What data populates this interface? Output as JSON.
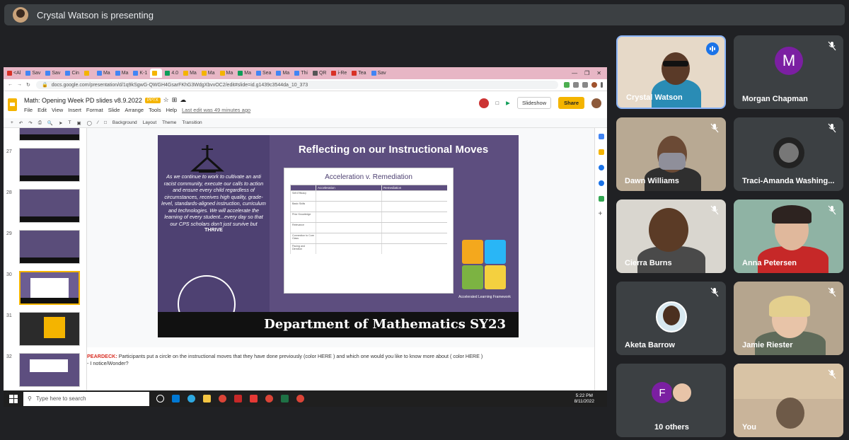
{
  "meeting": {
    "presenting_text": "Crystal Watson is presenting"
  },
  "browser": {
    "tabs": [
      {
        "label": "<Al",
        "color": "#d93025"
      },
      {
        "label": "Sav",
        "color": "#4285f4"
      },
      {
        "label": "Sav",
        "color": "#4285f4"
      },
      {
        "label": "Cin",
        "color": "#4285f4"
      },
      {
        "label": "",
        "color": "#f4b400"
      },
      {
        "label": "Ma",
        "color": "#4285f4"
      },
      {
        "label": "Ma",
        "color": "#4285f4"
      },
      {
        "label": "K-1",
        "color": "#4285f4"
      },
      {
        "label": "",
        "color": "#f4b400"
      },
      {
        "label": "4.0",
        "color": "#0f9d58"
      },
      {
        "label": "Ma",
        "color": "#f4b400"
      },
      {
        "label": "Ma",
        "color": "#f4b400"
      },
      {
        "label": "Ma",
        "color": "#f4b400"
      },
      {
        "label": "Ma",
        "color": "#0f9d58"
      },
      {
        "label": "Sea",
        "color": "#4285f4"
      },
      {
        "label": "Ma",
        "color": "#4285f4"
      },
      {
        "label": "Thi",
        "color": "#4285f4"
      },
      {
        "label": "QR",
        "color": "#555555"
      },
      {
        "label": "i-Re",
        "color": "#d93025"
      },
      {
        "label": "Tea",
        "color": "#d93025"
      },
      {
        "label": "Sav",
        "color": "#4285f4"
      }
    ],
    "url": "docs.google.com/presentation/d/1q9kSgwG-QWGH4GsarFKhG3WdgXbvvOC2/edit#slide=id.g1439c3544da_10_373"
  },
  "doc": {
    "title": "Math: Opening Week PD slides v8.9.2022",
    "badge": "PPTX",
    "menus": [
      "File",
      "Edit",
      "View",
      "Insert",
      "Format",
      "Slide",
      "Arrange",
      "Tools",
      "Help"
    ],
    "last_edit": "Last edit was 49 minutes ago",
    "slideshow_label": "Slideshow",
    "share_label": "Share",
    "toolbar": {
      "background": "Background",
      "layout": "Layout",
      "theme": "Theme",
      "transition": "Transition"
    }
  },
  "filmstrip": {
    "numbers": [
      "27",
      "28",
      "29",
      "30",
      "31",
      "32"
    ],
    "active": "30"
  },
  "slide": {
    "title": "Reflecting on our Instructional Moves",
    "body": "As we continue to work to cultivate an anti racist community, execute our calls to action and ensure every child regardless of circumstances, receives high quality, grade-level, standards-aligned instruction, curriculum and technologies. We will accelerate the learning of every student...every day so that our CPS scholars don't just survive but",
    "body_emphasis": "THRIVE",
    "inner_title": "Acceleration v. Remediation",
    "table_headers": [
      "",
      "Acceleration",
      "Remediation"
    ],
    "table_rows": [
      "Self-Efficacy",
      "Basic Skills",
      "Prior Knowledge",
      "Relevance",
      "Connection to Core Class",
      "Pacing and Direction"
    ],
    "puzzle_label": "Accelerated Learning Framework",
    "footer": "Department of Mathematics   SY23"
  },
  "notes": {
    "prefix": "PEARDECK:",
    "text": " Participants put a circle on the instructional moves that they have done previously (color HERE ) and which one would you like to know more about ( color HERE )",
    "line2": "- I notice/Wonder?"
  },
  "taskbar": {
    "search_placeholder": "Type here to search",
    "time": "5:22 PM",
    "date": "8/11/2022"
  },
  "participants": [
    {
      "name": "Crystal Watson",
      "speaking": true
    },
    {
      "name": "Morgan Chapman",
      "initial": "M",
      "muted": true
    },
    {
      "name": "Dawn Williams",
      "muted": true
    },
    {
      "name": "Traci-Amanda Washing...",
      "muted": true
    },
    {
      "name": "Cierra Burns",
      "muted": true
    },
    {
      "name": "Anna Petersen",
      "muted": true
    },
    {
      "name": "Aketa Barrow",
      "muted": true
    },
    {
      "name": "Jamie Riester",
      "muted": true
    },
    {
      "name": "10 others",
      "initial": "F"
    },
    {
      "name": "You",
      "muted": true
    }
  ]
}
